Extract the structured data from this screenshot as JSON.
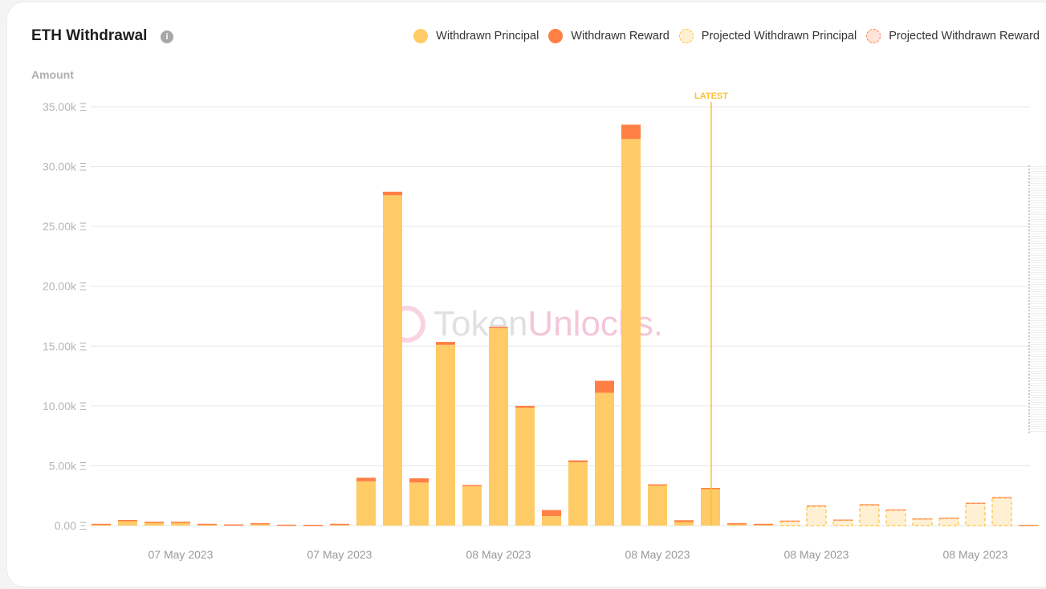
{
  "header": {
    "title": "ETH Withdrawal",
    "info_icon": "info-icon"
  },
  "watermark": "TokenUnlocks.",
  "chart_data": {
    "type": "bar",
    "stacked": true,
    "ylabel": "Amount",
    "ylim": [
      0,
      35000
    ],
    "yticks": [
      "0.00 Ξ",
      "5.00k Ξ",
      "10.00k Ξ",
      "15.00k Ξ",
      "20.00k Ξ",
      "25.00k Ξ",
      "30.00k Ξ",
      "35.00k Ξ"
    ],
    "xtick_labels": [
      "07 May 2023",
      "07 May 2023",
      "08 May 2023",
      "08 May 2023",
      "08 May 2023",
      "08 May 2023"
    ],
    "grid": true,
    "legend_position": "top-right",
    "annotation": {
      "label": "LATEST",
      "bar_index": 23,
      "color": "#ffbf33"
    },
    "colors": {
      "principal": "#ffcb66",
      "reward": "#ff7f45",
      "projected_principal": "#fff0d4",
      "projected_reward": "#ffe3d8",
      "projected_border": "#ffbf33"
    },
    "series": [
      {
        "name": "Withdrawn Principal",
        "values": [
          100,
          420,
          280,
          280,
          120,
          80,
          170,
          60,
          50,
          120,
          3700,
          27600,
          3600,
          15100,
          3300,
          16500,
          9850,
          800,
          5300,
          11100,
          32300,
          3400,
          300,
          3100,
          150,
          120,
          0,
          0,
          0,
          0,
          0,
          0,
          0,
          0,
          0,
          0
        ]
      },
      {
        "name": "Withdrawn Reward",
        "values": [
          50,
          50,
          50,
          50,
          30,
          20,
          30,
          20,
          20,
          30,
          300,
          300,
          350,
          250,
          100,
          100,
          150,
          500,
          150,
          1000,
          1200,
          50,
          150,
          50,
          50,
          30,
          0,
          0,
          0,
          0,
          0,
          0,
          0,
          0,
          0,
          0
        ]
      },
      {
        "name": "Projected Withdrawn Principal",
        "values": [
          0,
          0,
          0,
          0,
          0,
          0,
          0,
          0,
          0,
          0,
          0,
          0,
          0,
          0,
          0,
          0,
          0,
          0,
          0,
          0,
          0,
          0,
          0,
          0,
          0,
          0,
          350,
          1600,
          450,
          1700,
          1300,
          550,
          600,
          1850,
          2300,
          30
        ]
      },
      {
        "name": "Projected Withdrawn Reward",
        "values": [
          0,
          0,
          0,
          0,
          0,
          0,
          0,
          0,
          0,
          0,
          0,
          0,
          0,
          0,
          0,
          0,
          0,
          0,
          0,
          0,
          0,
          0,
          0,
          0,
          0,
          0,
          80,
          100,
          60,
          100,
          60,
          60,
          60,
          60,
          100,
          40
        ]
      }
    ]
  }
}
